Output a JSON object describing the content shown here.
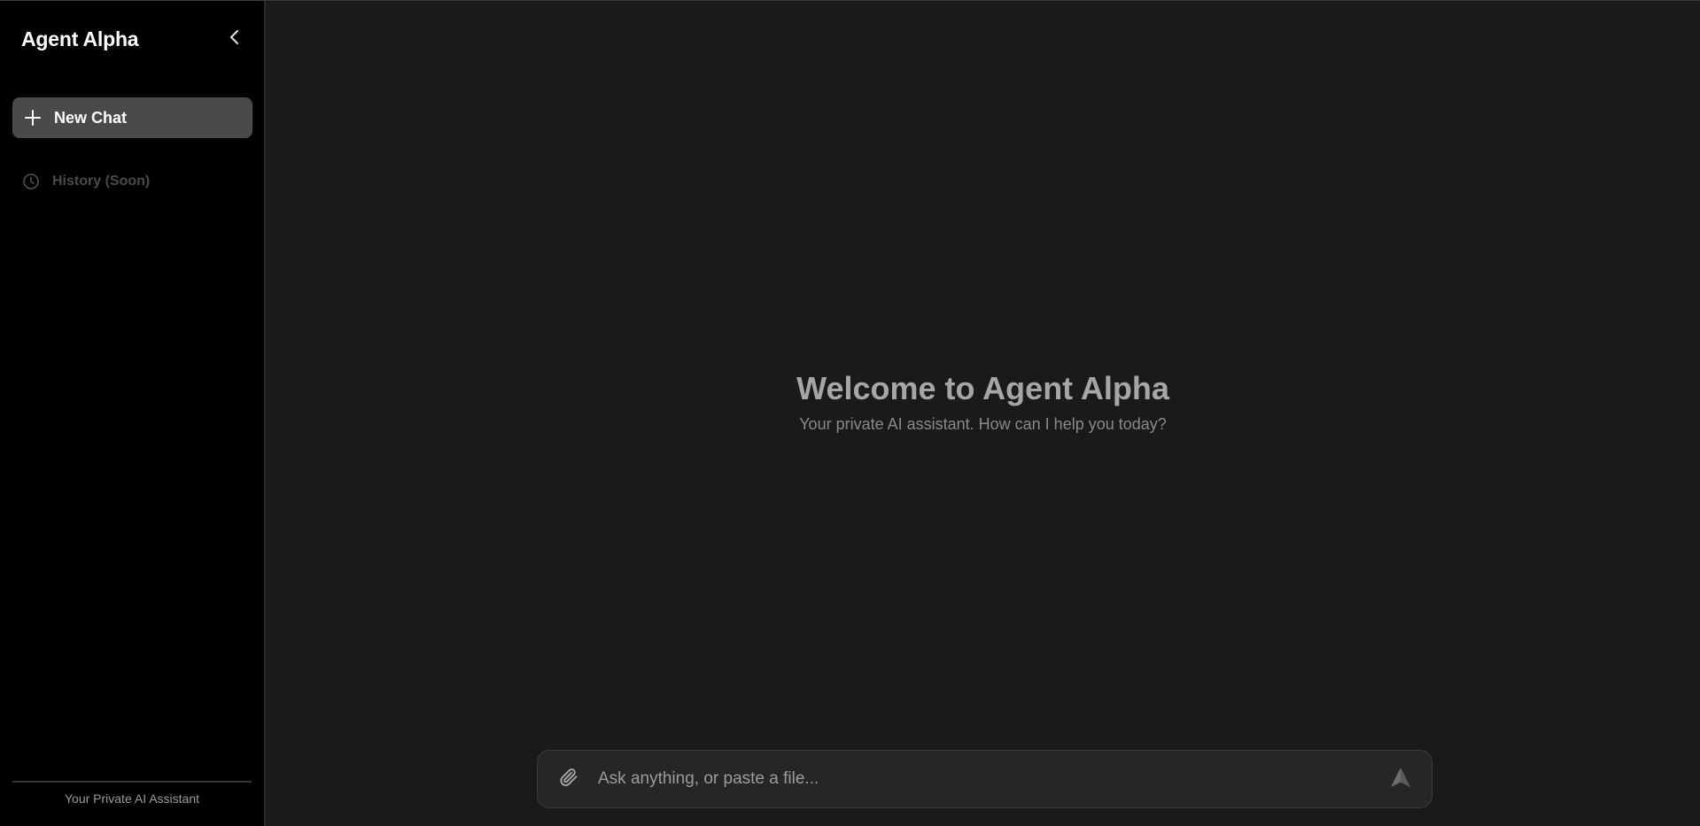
{
  "sidebar": {
    "app_title": "Agent Alpha",
    "collapse_icon": "chevron-left-icon",
    "new_chat": {
      "label": "New Chat",
      "icon": "plus-icon"
    },
    "history": {
      "label": "History (Soon)",
      "icon": "clock-icon"
    },
    "footer_text": "Your Private AI Assistant"
  },
  "main": {
    "welcome_title": "Welcome to Agent Alpha",
    "welcome_subtitle": "Your private AI assistant. How can I help you today?"
  },
  "composer": {
    "placeholder": "Ask anything, or paste a file...",
    "value": "",
    "attach_icon": "paperclip-icon",
    "send_icon": "send-icon"
  },
  "colors": {
    "sidebar_bg": "#000000",
    "main_bg": "#1a1a1a",
    "new_chat_bg": "#4a4a4a",
    "composer_bg": "#262626"
  }
}
